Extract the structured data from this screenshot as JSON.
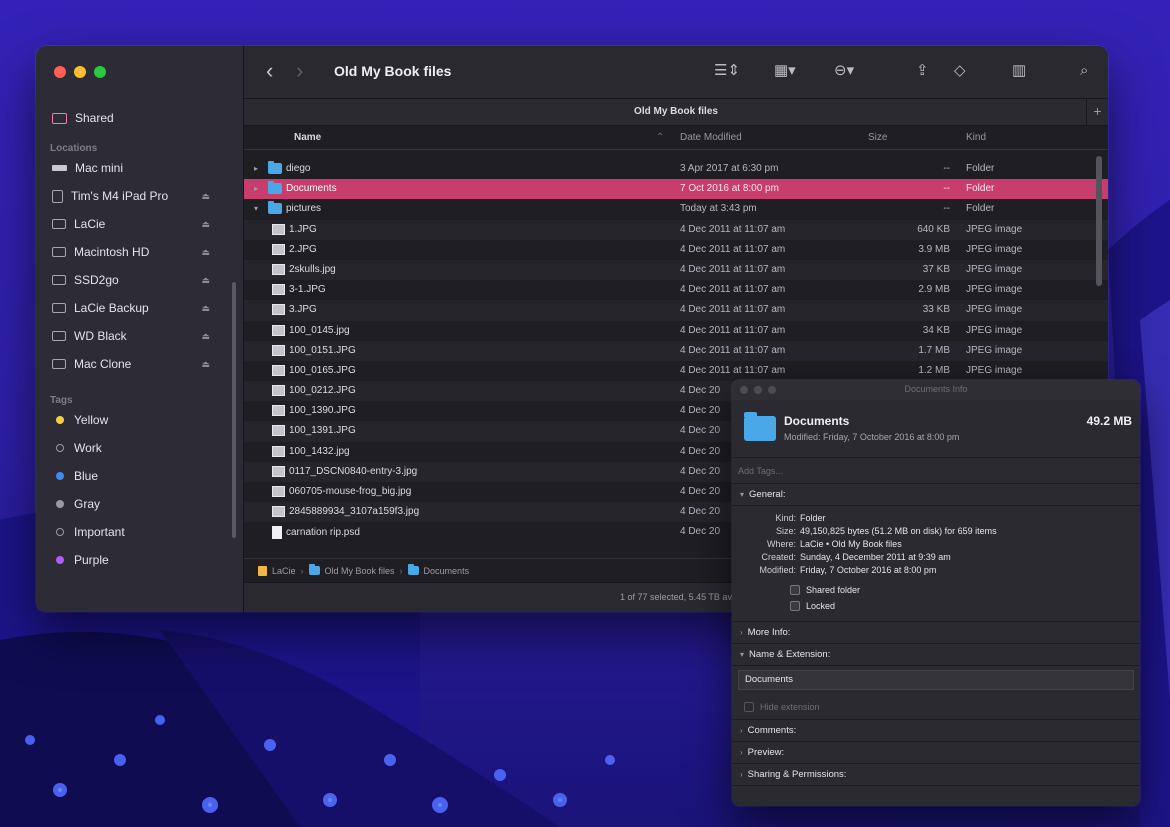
{
  "colors": {
    "accent": "#c73d6c",
    "folder": "#4aa7e8",
    "tag_yellow": "#f4d03f",
    "tag_blue": "#3d8bf2",
    "tag_gray": "#9b99a5",
    "tag_purple": "#b35cf2"
  },
  "finder": {
    "title": "Old My Book files",
    "tab_title": "Old My Book files",
    "sidebar": {
      "shared": "Shared",
      "locations_header": "Locations",
      "locations": [
        {
          "label": "Mac mini",
          "icon": "mac-icon"
        },
        {
          "label": "Tim's M4 iPad Pro",
          "icon": "tablet-icon"
        },
        {
          "label": "LaCie",
          "icon": "drive-icon"
        },
        {
          "label": "Macintosh HD",
          "icon": "drive-icon"
        },
        {
          "label": "SSD2go",
          "icon": "drive-icon"
        },
        {
          "label": "LaCie Backup",
          "icon": "drive-icon"
        },
        {
          "label": "WD Black",
          "icon": "drive-icon"
        },
        {
          "label": "Mac Clone",
          "icon": "drive-icon"
        }
      ],
      "tags_header": "Tags",
      "tags": [
        {
          "label": "Yellow",
          "color": "#f4d03f"
        },
        {
          "label": "Work",
          "color": "hollow"
        },
        {
          "label": "Blue",
          "color": "#3d8bf2"
        },
        {
          "label": "Gray",
          "color": "#9b99a5"
        },
        {
          "label": "Important",
          "color": "hollow"
        },
        {
          "label": "Purple",
          "color": "#b35cf2"
        }
      ]
    },
    "columns": {
      "name": "Name",
      "date": "Date Modified",
      "size": "Size",
      "kind": "Kind"
    },
    "rows": [
      {
        "name": "diego",
        "date": "3 Apr 2017 at 6:30 pm",
        "size": "--",
        "kind": "Folder",
        "type": "folder",
        "level": 0,
        "disclosure": "▸"
      },
      {
        "name": "Documents",
        "date": "7 Oct 2016 at 8:00 pm",
        "size": "--",
        "kind": "Folder",
        "type": "folder",
        "level": 0,
        "disclosure": "▸",
        "selected": true
      },
      {
        "name": "pictures",
        "date": "Today at 3:43 pm",
        "size": "--",
        "kind": "Folder",
        "type": "folder",
        "level": 0,
        "disclosure": "▾"
      },
      {
        "name": "1.JPG",
        "date": "4 Dec 2011 at 11:07 am",
        "size": "640 KB",
        "kind": "JPEG image",
        "type": "image",
        "level": 1
      },
      {
        "name": "2.JPG",
        "date": "4 Dec 2011 at 11:07 am",
        "size": "3.9 MB",
        "kind": "JPEG image",
        "type": "image",
        "level": 1
      },
      {
        "name": "2skulls.jpg",
        "date": "4 Dec 2011 at 11:07 am",
        "size": "37 KB",
        "kind": "JPEG image",
        "type": "image",
        "level": 1
      },
      {
        "name": "3-1.JPG",
        "date": "4 Dec 2011 at 11:07 am",
        "size": "2.9 MB",
        "kind": "JPEG image",
        "type": "image",
        "level": 1
      },
      {
        "name": "3.JPG",
        "date": "4 Dec 2011 at 11:07 am",
        "size": "33 KB",
        "kind": "JPEG image",
        "type": "image",
        "level": 1
      },
      {
        "name": "100_0145.jpg",
        "date": "4 Dec 2011 at 11:07 am",
        "size": "34 KB",
        "kind": "JPEG image",
        "type": "image",
        "level": 1
      },
      {
        "name": "100_0151.JPG",
        "date": "4 Dec 2011 at 11:07 am",
        "size": "1.7 MB",
        "kind": "JPEG image",
        "type": "image",
        "level": 1
      },
      {
        "name": "100_0165.JPG",
        "date": "4 Dec 2011 at 11:07 am",
        "size": "1.2 MB",
        "kind": "JPEG image",
        "type": "image",
        "level": 1
      },
      {
        "name": "100_0212.JPG",
        "date": "4 Dec 20",
        "size": "",
        "kind": "",
        "type": "image",
        "level": 1
      },
      {
        "name": "100_1390.JPG",
        "date": "4 Dec 20",
        "size": "",
        "kind": "",
        "type": "image",
        "level": 1
      },
      {
        "name": "100_1391.JPG",
        "date": "4 Dec 20",
        "size": "",
        "kind": "",
        "type": "image",
        "level": 1
      },
      {
        "name": "100_1432.jpg",
        "date": "4 Dec 20",
        "size": "",
        "kind": "",
        "type": "image",
        "level": 1
      },
      {
        "name": "0117_DSCN0840-entry-3.jpg",
        "date": "4 Dec 20",
        "size": "",
        "kind": "",
        "type": "image",
        "level": 1
      },
      {
        "name": "060705-mouse-frog_big.jpg",
        "date": "4 Dec 20",
        "size": "",
        "kind": "",
        "type": "image",
        "level": 1
      },
      {
        "name": "2845889934_3107a159f3.jpg",
        "date": "4 Dec 20",
        "size": "",
        "kind": "",
        "type": "image",
        "level": 1
      },
      {
        "name": "carnation rip.psd",
        "date": "4 Dec 20",
        "size": "",
        "kind": "",
        "type": "doc",
        "level": 1
      }
    ],
    "path": [
      "LaCie",
      "Old My Book files",
      "Documents"
    ],
    "status": "1 of 77 selected, 5.45 TB av"
  },
  "info": {
    "window_title": "Documents Info",
    "name": "Documents",
    "size": "49.2 MB",
    "modified_line": "Modified: Friday, 7 October 2016 at 8:00 pm",
    "tags_placeholder": "Add Tags...",
    "general_label": "General:",
    "general": [
      {
        "k": "Kind:",
        "v": "Folder"
      },
      {
        "k": "Size:",
        "v": "49,150,825 bytes (51.2 MB on disk) for 659 items"
      },
      {
        "k": "Where:",
        "v": "LaCie • Old My Book files"
      },
      {
        "k": "Created:",
        "v": "Sunday, 4 December 2011 at 9:39 am"
      },
      {
        "k": "Modified:",
        "v": "Friday, 7 October 2016 at 8:00 pm"
      }
    ],
    "shared_folder": "Shared folder",
    "locked": "Locked",
    "more_info": "More Info:",
    "name_ext": "Name & Extension:",
    "name_field": "Documents",
    "hide_extension": "Hide extension",
    "comments": "Comments:",
    "preview": "Preview:",
    "sharing": "Sharing & Permissions:"
  }
}
